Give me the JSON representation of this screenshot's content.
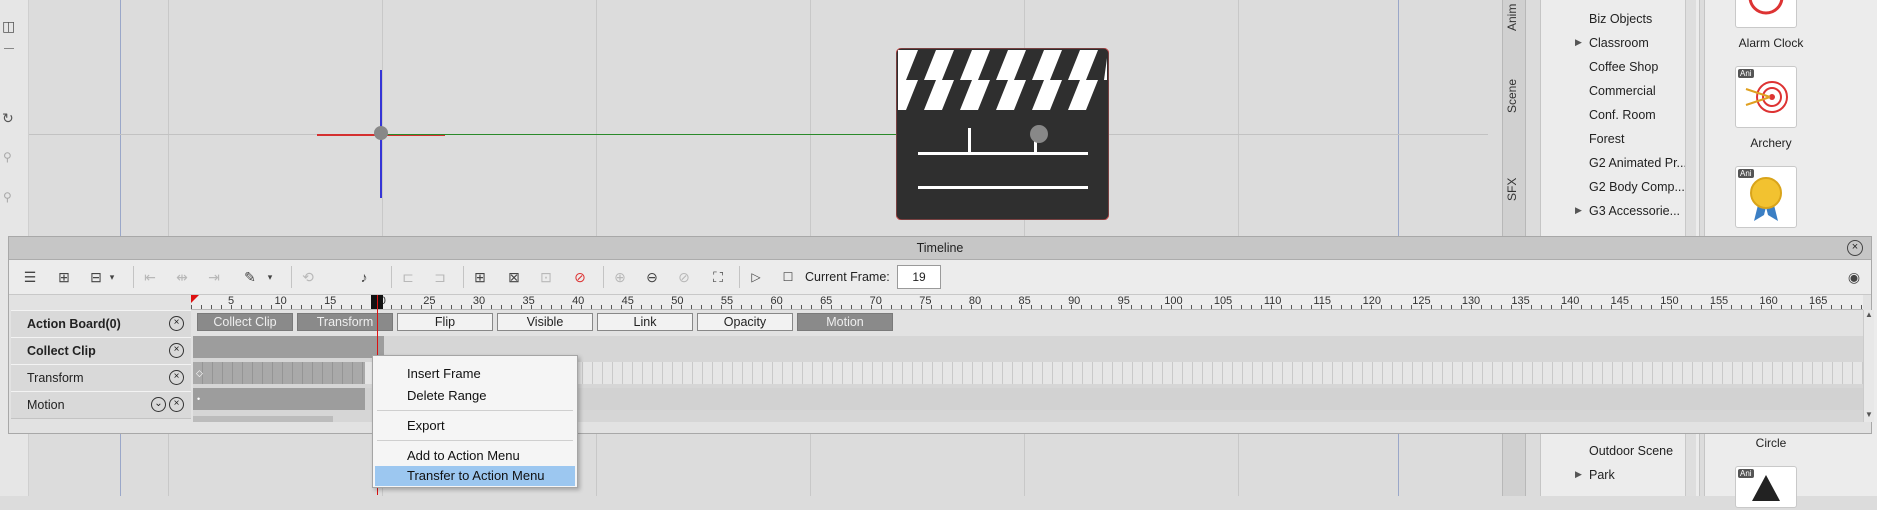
{
  "side_tabs": [
    "Anim",
    "Scene",
    "SFX"
  ],
  "tree": {
    "items": [
      {
        "label": "Biz Objects",
        "expandable": false
      },
      {
        "label": "Classroom",
        "expandable": true
      },
      {
        "label": "Coffee Shop",
        "expandable": false
      },
      {
        "label": "Commercial",
        "expandable": false
      },
      {
        "label": "Conf. Room",
        "expandable": false
      },
      {
        "label": "Forest",
        "expandable": false
      },
      {
        "label": "G2 Animated Pr...",
        "expandable": false
      },
      {
        "label": "G2 Body Comp...",
        "expandable": false
      },
      {
        "label": "G3 Accessorie...",
        "expandable": true
      }
    ],
    "bottom_items": [
      {
        "label": "Outdoor Scene",
        "expandable": false
      },
      {
        "label": "Park",
        "expandable": true
      }
    ]
  },
  "content": {
    "thumbs": [
      {
        "label": "Alarm Clock",
        "badge": "Ani"
      },
      {
        "label": "Archery",
        "badge": "Ani"
      },
      {
        "label": "",
        "badge": "Ani"
      }
    ],
    "bottom_label": "Circle"
  },
  "timeline": {
    "title": "Timeline",
    "current_frame_label": "Current Frame:",
    "current_frame": "19",
    "ruler_numbers": [
      "5",
      "10",
      "15",
      "20",
      "25",
      "30",
      "35",
      "40",
      "45",
      "50",
      "55",
      "60",
      "65",
      "70",
      "75",
      "80",
      "85",
      "90",
      "95",
      "100",
      "105",
      "110",
      "115",
      "120",
      "125",
      "130",
      "135",
      "140",
      "145",
      "150",
      "155",
      "160",
      "165"
    ],
    "tracks": [
      {
        "name": "Action Board(0)",
        "bold": true
      },
      {
        "name": "Collect Clip",
        "bold": true
      },
      {
        "name": "Transform",
        "bold": false
      },
      {
        "name": "Motion",
        "bold": false
      }
    ],
    "action_chips": [
      {
        "label": "Collect Clip",
        "dark": true
      },
      {
        "label": "Transform",
        "dark": true
      },
      {
        "label": "Flip",
        "dark": false
      },
      {
        "label": "Visible",
        "dark": false
      },
      {
        "label": "Link",
        "dark": false
      },
      {
        "label": "Opacity",
        "dark": false
      },
      {
        "label": "Motion",
        "dark": true
      }
    ]
  },
  "context_menu": {
    "insert_frame": "Insert Frame",
    "delete_range": "Delete Range",
    "export": "Export",
    "add_to_action_menu": "Add to Action Menu",
    "transfer_to_action_menu": "Transfer to Action Menu",
    "selected": "Transfer to Action Menu"
  },
  "colors": {
    "menu_highlight": "#9cc7f0",
    "playhead": "#dd1111",
    "viewport_bg": "#dcdcdc"
  }
}
